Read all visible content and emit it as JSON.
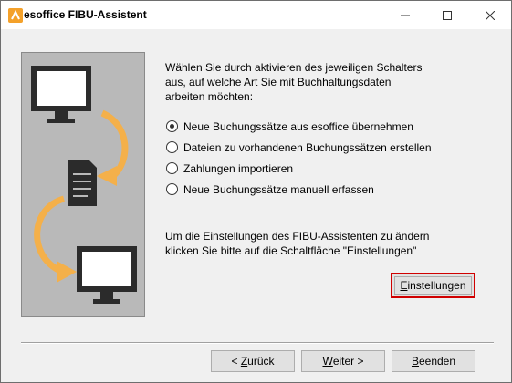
{
  "window": {
    "title": "esoffice FIBU-Assistent",
    "controls": {
      "minimize": "minimize",
      "maximize": "maximize",
      "close": "close"
    }
  },
  "intro": {
    "text": "Wählen Sie durch aktivieren des jeweiligen Schalters\naus, auf welche Art Sie mit Buchhaltungsdaten\narbeiten möchten:"
  },
  "options": [
    {
      "label": "Neue Buchungssätze aus esoffice übernehmen",
      "checked": true
    },
    {
      "label": "Dateien zu vorhandenen Buchungssätzen erstellen",
      "checked": false
    },
    {
      "label": "Zahlungen importieren",
      "checked": false
    },
    {
      "label": "Neue Buchungssätze manuell erfassen",
      "checked": false
    }
  ],
  "info": {
    "text": "Um die Einstellungen des FIBU-Assistenten zu ändern\nklicken Sie bitte auf die Schaltfläche \"Einstellungen\""
  },
  "buttons": {
    "settings_mnemonic": "E",
    "settings_rest": "instellungen",
    "back_prefix": "< ",
    "back_mnemonic": "Z",
    "back_rest": "urück",
    "next_mnemonic": "W",
    "next_rest": "eiter >",
    "finish_mnemonic": "B",
    "finish_rest": "eenden"
  },
  "colors": {
    "accent_orange": "#f4b04a",
    "highlight_red": "#d00000",
    "panel_gray": "#b9b9b9",
    "icon_dark": "#2b2b2b"
  }
}
